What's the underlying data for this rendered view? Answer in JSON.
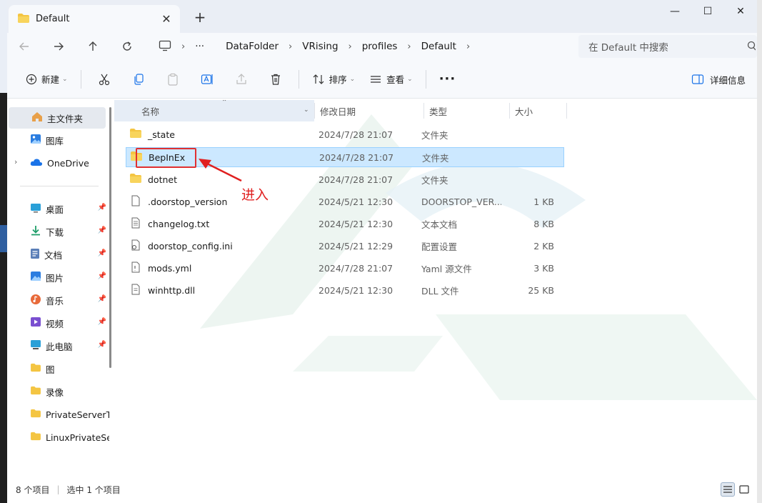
{
  "colors": {
    "selection_bg": "#cce8ff",
    "annotation": "#e02020",
    "folder": "#f4c542",
    "accent_blue": "#1a73e8"
  },
  "tab": {
    "title": "Default",
    "close": "✕",
    "new": "+"
  },
  "window_controls": {
    "minimize": "—",
    "maximize": "☐",
    "close": "✕"
  },
  "nav": {
    "more": "···"
  },
  "breadcrumb": [
    "DataFolder",
    "VRising",
    "profiles",
    "Default"
  ],
  "search": {
    "placeholder": "在 Default 中搜索"
  },
  "toolbar": {
    "new_label": "新建",
    "sort_label": "排序",
    "view_label": "查看",
    "more_label": "···",
    "details_label": "详细信息"
  },
  "sidebar": {
    "items": [
      {
        "label": "主文件夹",
        "icon": "home-icon"
      },
      {
        "label": "图库",
        "icon": "gallery-icon"
      },
      {
        "label": "OneDrive",
        "icon": "cloud-icon"
      },
      {
        "label": "桌面",
        "icon": "desktop-icon"
      },
      {
        "label": "下载",
        "icon": "download-icon"
      },
      {
        "label": "文档",
        "icon": "document-icon"
      },
      {
        "label": "图片",
        "icon": "pictures-icon"
      },
      {
        "label": "音乐",
        "icon": "music-icon"
      },
      {
        "label": "视频",
        "icon": "video-icon"
      },
      {
        "label": "此电脑",
        "icon": "computer-icon"
      },
      {
        "label": "图",
        "icon": "folder-icon"
      },
      {
        "label": "录像",
        "icon": "folder-icon"
      },
      {
        "label": "PrivateServerT",
        "icon": "folder-icon"
      },
      {
        "label": "LinuxPrivateSer",
        "icon": "folder-icon"
      }
    ]
  },
  "columns": {
    "name": "名称",
    "date": "修改日期",
    "type": "类型",
    "size": "大小"
  },
  "files": [
    {
      "name": "_state",
      "date": "2024/7/28 21:07",
      "type": "文件夹",
      "size": "",
      "icon": "folder-icon"
    },
    {
      "name": "BepInEx",
      "date": "2024/7/28 21:07",
      "type": "文件夹",
      "size": "",
      "icon": "folder-icon"
    },
    {
      "name": "dotnet",
      "date": "2024/7/28 21:07",
      "type": "文件夹",
      "size": "",
      "icon": "folder-icon"
    },
    {
      "name": ".doorstop_version",
      "date": "2024/5/21 12:30",
      "type": "DOORSTOP_VER...",
      "size": "1 KB",
      "icon": "file-icon"
    },
    {
      "name": "changelog.txt",
      "date": "2024/5/21 12:30",
      "type": "文本文档",
      "size": "8 KB",
      "icon": "text-file-icon"
    },
    {
      "name": "doorstop_config.ini",
      "date": "2024/5/21 12:29",
      "type": "配置设置",
      "size": "2 KB",
      "icon": "config-file-icon"
    },
    {
      "name": "mods.yml",
      "date": "2024/7/28 21:07",
      "type": "Yaml 源文件",
      "size": "3 KB",
      "icon": "code-file-icon"
    },
    {
      "name": "winhttp.dll",
      "date": "2024/5/21 12:30",
      "type": "DLL 文件",
      "size": "25 KB",
      "icon": "dll-file-icon"
    }
  ],
  "annotation": {
    "text": "进入"
  },
  "status": {
    "count": "8 个项目",
    "selected": "选中 1 个项目"
  }
}
